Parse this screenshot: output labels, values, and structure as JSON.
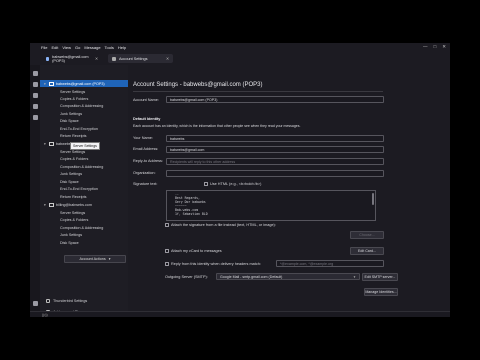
{
  "menu": [
    "File",
    "Edit",
    "View",
    "Go",
    "Message",
    "Tools",
    "Help"
  ],
  "window_controls": {
    "minimize": "—",
    "maximize": "□",
    "close": "✕"
  },
  "tabs": [
    {
      "label": "babwebs@gmail.com (POP3)",
      "close": "✕"
    },
    {
      "label": "Account Settings",
      "close": "✕"
    }
  ],
  "tree": {
    "selected_account": "babwebs@gmail.com (POP3)",
    "tooltip": "Server Settings",
    "accounts": [
      {
        "name": "babwebs@gmail.com (POP3)",
        "items": [
          "Server Settings",
          "Copies & Folders",
          "Composition & Addressing",
          "Junk Settings",
          "Disk Space",
          "End-To-End Encryption",
          "Return Receipts"
        ]
      },
      {
        "name": "babwebs@babwebs.com",
        "items": [
          "Server Settings",
          "Copies & Folders",
          "Composition & Addressing",
          "Junk Settings",
          "Disk Space",
          "End-To-End Encryption",
          "Return Receipts"
        ]
      },
      {
        "name": "billing@babwebs.com",
        "items": [
          "Server Settings",
          "Copies & Folders",
          "Composition & Addressing",
          "Junk Settings",
          "Disk Space"
        ]
      }
    ],
    "account_actions": "Account Actions",
    "account_actions_arrow": "▾",
    "bottom": [
      "Thunderbird Settings",
      "Add-ons and Themes"
    ]
  },
  "settings": {
    "title": "Account Settings - babwebs@gmail.com (POP3)",
    "account_name_label": "Account Name:",
    "account_name_value": "babwebs@gmail.com (POP3)",
    "default_identity": "Default Identity",
    "identity_desc": "Each account has an identity, which is the information that other people see when they read your messages.",
    "your_name_label": "Your Name:",
    "your_name_value": "babwebs",
    "email_label": "Email Address:",
    "email_value": "babwebs@gmail.com",
    "reply_label": "Reply-to Address:",
    "reply_placeholder": "Recipients will reply to this other address",
    "org_label": "Organization:",
    "org_value": "",
    "sig_label": "Signature text:",
    "sig_html_label": "Use HTML (e.g., <b>bold</b>)",
    "signature_lines": [
      "--",
      "Best Regards,",
      "Gery Dor babwebs",
      "~~~~~~",
      "Bab.webs.com",
      "1f, Sebastian BLD"
    ],
    "attach_sig_label": "Attach the signature from a file instead (text, HTML, or image):",
    "choose_btn": "Choose...",
    "vcard_label": "Attach my vCard to messages",
    "edit_card_btn": "Edit Card...",
    "reply_from_label": "Reply from this identity when delivery headers match:",
    "reply_from_placeholder": "*@example.com, *@example.org",
    "smtp_label": "Outgoing Server (SMTP):",
    "smtp_value": "Google Mail - smtp.gmail.com (Default)",
    "edit_smtp_btn": "Edit SMTP server...",
    "manage_btn": "Manage Identities..."
  },
  "status_icon": "((•))"
}
